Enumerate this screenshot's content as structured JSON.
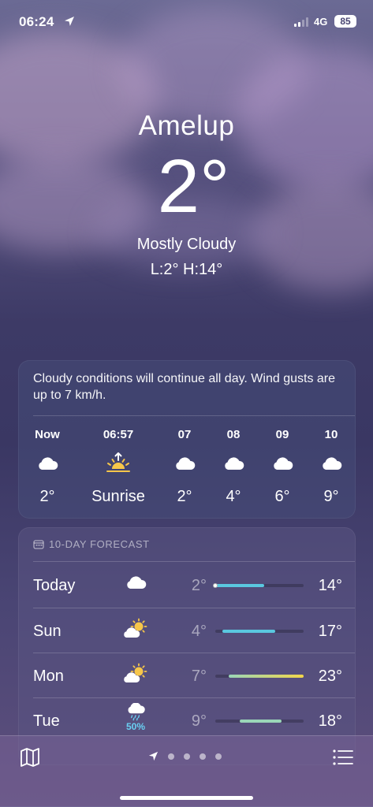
{
  "status_bar": {
    "time": "06:24",
    "network": "4G",
    "battery": "85"
  },
  "location": {
    "city": "Amelup",
    "temperature": "2°",
    "condition": "Mostly Cloudy",
    "low_high": "L:2° H:14°"
  },
  "hourly_card": {
    "summary": "Cloudy conditions will continue all day. Wind gusts are up to 7 km/h.",
    "hours": [
      {
        "label": "Now",
        "icon": "cloud-icon",
        "value": "2°"
      },
      {
        "label": "06:57",
        "icon": "sunrise-icon",
        "value": "Sunrise"
      },
      {
        "label": "07",
        "icon": "cloud-icon",
        "value": "2°"
      },
      {
        "label": "08",
        "icon": "cloud-icon",
        "value": "4°"
      },
      {
        "label": "09",
        "icon": "cloud-icon",
        "value": "6°"
      },
      {
        "label": "10",
        "icon": "cloud-icon",
        "value": "9°"
      }
    ]
  },
  "forecast_card": {
    "header": "10-DAY FORECAST",
    "days": [
      {
        "name": "Today",
        "icon": "cloud-icon",
        "low": "2°",
        "high": "14°",
        "precip": "",
        "range_start": 0.0,
        "range_end": 0.55,
        "current_marker": 0.0
      },
      {
        "name": "Sun",
        "icon": "partly-sunny-icon",
        "low": "4°",
        "high": "17°",
        "precip": "",
        "range_start": 0.08,
        "range_end": 0.68
      },
      {
        "name": "Mon",
        "icon": "partly-sunny-icon",
        "low": "7°",
        "high": "23°",
        "precip": "",
        "range_start": 0.15,
        "range_end": 1.0
      },
      {
        "name": "Tue",
        "icon": "rain-cloud-icon",
        "low": "9°",
        "high": "18°",
        "precip": "50%",
        "range_start": 0.28,
        "range_end": 0.75
      }
    ]
  },
  "colors": {
    "bar_cool": "#5ac8e0",
    "bar_mild": "#9ad6b8",
    "bar_warm": "#f2d64a",
    "rain_accent": "#6ad0f2"
  }
}
